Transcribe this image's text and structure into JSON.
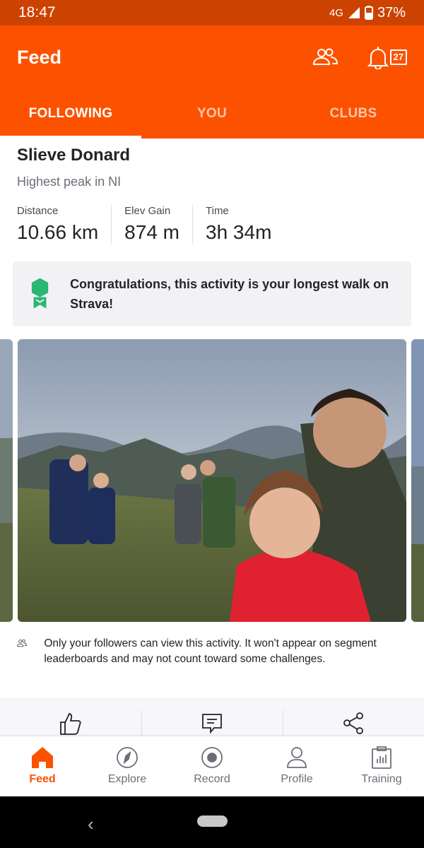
{
  "status_bar": {
    "time": "18:47",
    "network": "4G",
    "battery": "37%"
  },
  "header": {
    "title": "Feed",
    "notification_count": "27",
    "icons": [
      "friends-icon",
      "bell-icon"
    ]
  },
  "tabs": [
    {
      "label": "FOLLOWING",
      "active": true
    },
    {
      "label": "YOU",
      "active": false
    },
    {
      "label": "CLUBS",
      "active": false
    }
  ],
  "activity": {
    "title": "Slieve Donard",
    "description": "Highest peak in NI",
    "stats": [
      {
        "label": "Distance",
        "value": "10.66 km"
      },
      {
        "label": "Elev Gain",
        "value": "874 m"
      },
      {
        "label": "Time",
        "value": "3h 34m"
      }
    ],
    "achievement": "Congratulations, this activity is your longest walk on Strava!",
    "privacy_note": "Only your followers can view this activity. It won't appear on segment leaderboards and may not count toward some challenges.",
    "actions": [
      "kudos-icon",
      "comment-icon",
      "share-icon"
    ]
  },
  "bottom_nav": [
    {
      "label": "Feed",
      "icon": "home-icon",
      "active": true
    },
    {
      "label": "Explore",
      "icon": "compass-icon",
      "active": false
    },
    {
      "label": "Record",
      "icon": "record-icon",
      "active": false
    },
    {
      "label": "Profile",
      "icon": "profile-icon",
      "active": false
    },
    {
      "label": "Training",
      "icon": "training-icon",
      "active": false
    }
  ],
  "colors": {
    "brand": "#fc5200",
    "status_bar": "#cc4200",
    "achievement_green": "#2bb673"
  }
}
